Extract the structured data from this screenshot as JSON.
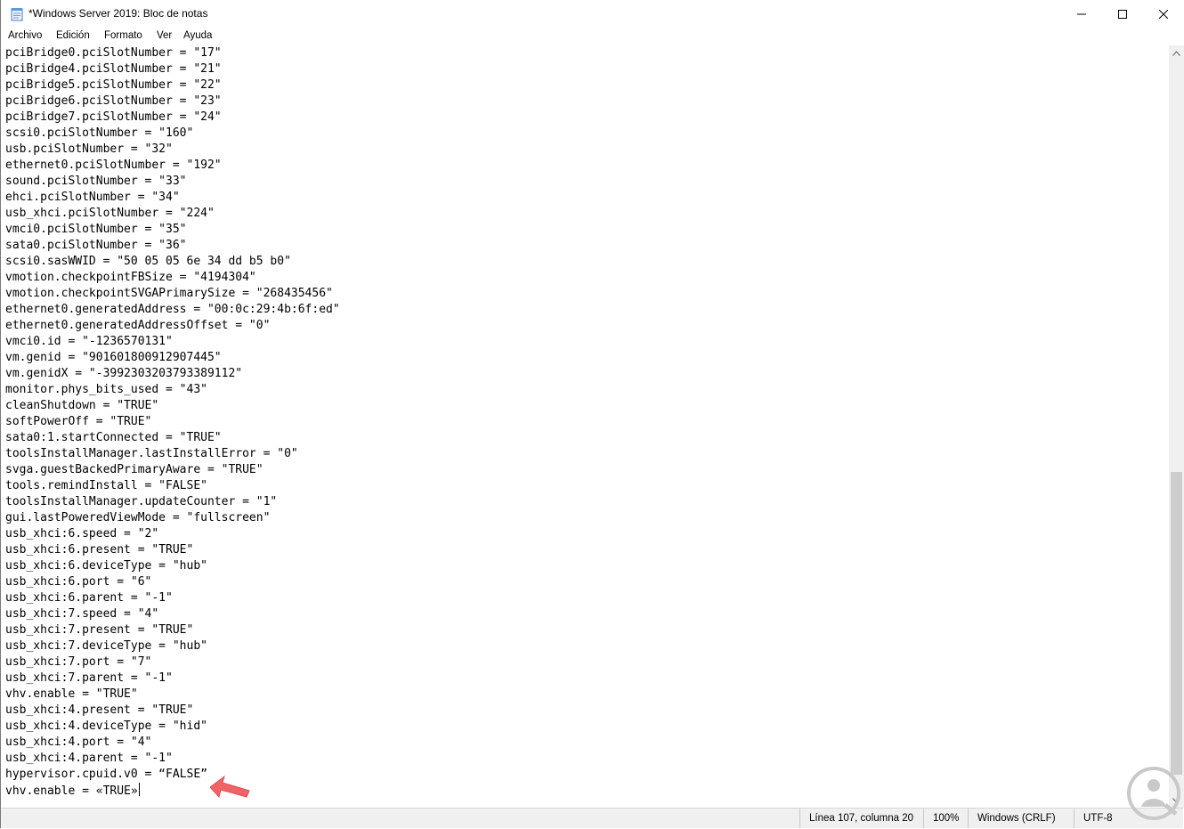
{
  "window": {
    "title": "*Windows Server 2019: Bloc de notas",
    "app_icon": "notepad-icon"
  },
  "controls": {
    "minimize_icon": "minimize-icon",
    "maximize_icon": "maximize-icon",
    "close_icon": "close-icon"
  },
  "menu": {
    "items": [
      "Archivo",
      "Edición",
      "Formato",
      "Ver",
      "Ayuda"
    ]
  },
  "editor": {
    "lines": [
      "pciBridge0.pciSlotNumber = \"17\"",
      "pciBridge4.pciSlotNumber = \"21\"",
      "pciBridge5.pciSlotNumber = \"22\"",
      "pciBridge6.pciSlotNumber = \"23\"",
      "pciBridge7.pciSlotNumber = \"24\"",
      "scsi0.pciSlotNumber = \"160\"",
      "usb.pciSlotNumber = \"32\"",
      "ethernet0.pciSlotNumber = \"192\"",
      "sound.pciSlotNumber = \"33\"",
      "ehci.pciSlotNumber = \"34\"",
      "usb_xhci.pciSlotNumber = \"224\"",
      "vmci0.pciSlotNumber = \"35\"",
      "sata0.pciSlotNumber = \"36\"",
      "scsi0.sasWWID = \"50 05 05 6e 34 dd b5 b0\"",
      "vmotion.checkpointFBSize = \"4194304\"",
      "vmotion.checkpointSVGAPrimarySize = \"268435456\"",
      "ethernet0.generatedAddress = \"00:0c:29:4b:6f:ed\"",
      "ethernet0.generatedAddressOffset = \"0\"",
      "vmci0.id = \"-1236570131\"",
      "vm.genid = \"901601800912907445\"",
      "vm.genidX = \"-3992303203793389112\"",
      "monitor.phys_bits_used = \"43\"",
      "cleanShutdown = \"TRUE\"",
      "softPowerOff = \"TRUE\"",
      "sata0:1.startConnected = \"TRUE\"",
      "toolsInstallManager.lastInstallError = \"0\"",
      "svga.guestBackedPrimaryAware = \"TRUE\"",
      "tools.remindInstall = \"FALSE\"",
      "toolsInstallManager.updateCounter = \"1\"",
      "gui.lastPoweredViewMode = \"fullscreen\"",
      "usb_xhci:6.speed = \"2\"",
      "usb_xhci:6.present = \"TRUE\"",
      "usb_xhci:6.deviceType = \"hub\"",
      "usb_xhci:6.port = \"6\"",
      "usb_xhci:6.parent = \"-1\"",
      "usb_xhci:7.speed = \"4\"",
      "usb_xhci:7.present = \"TRUE\"",
      "usb_xhci:7.deviceType = \"hub\"",
      "usb_xhci:7.port = \"7\"",
      "usb_xhci:7.parent = \"-1\"",
      "vhv.enable = \"TRUE\"",
      "usb_xhci:4.present = \"TRUE\"",
      "usb_xhci:4.deviceType = \"hid\"",
      "usb_xhci:4.port = \"4\"",
      "usb_xhci:4.parent = \"-1\"",
      "hypervisor.cpuid.v0 = “FALSE”",
      "vhv.enable = «TRUE»"
    ]
  },
  "statusbar": {
    "position": "Línea 107, columna 20",
    "zoom": "100%",
    "line_ending": "Windows (CRLF)",
    "encoding": "UTF-8"
  },
  "annotation": {
    "arrow_color": "#f06467",
    "arrow_icon": "pointer-arrow-icon"
  },
  "watermark": {
    "icon": "solvetic-logo-icon",
    "color": "#c9c9c9"
  }
}
